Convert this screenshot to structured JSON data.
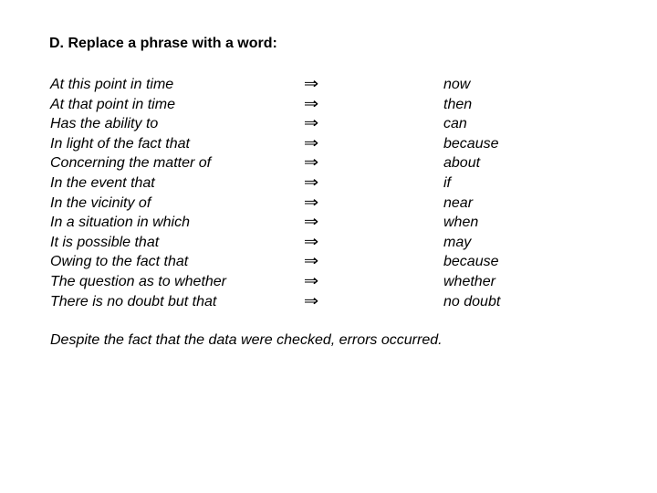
{
  "slide": {
    "title": "D. Replace a phrase with a word:",
    "arrow_symbol": "⇒",
    "rows": [
      {
        "phrase": "At this point in time",
        "word": "now"
      },
      {
        "phrase": "At that point in time",
        "word": "then"
      },
      {
        "phrase": "Has the ability to",
        "word": "can"
      },
      {
        "phrase": "In light of the fact that",
        "word": "because"
      },
      {
        "phrase": "Concerning the matter of",
        "word": "about"
      },
      {
        "phrase": "In the event that",
        "word": "if"
      },
      {
        "phrase": "In the vicinity of",
        "word": "near"
      },
      {
        "phrase": "In a situation in which",
        "word": "when"
      },
      {
        "phrase": "It is possible that",
        "word": "may"
      },
      {
        "phrase": "Owing to the fact that",
        "word": "because"
      },
      {
        "phrase": "The question as to whether",
        "word": "whether"
      },
      {
        "phrase": "There is no doubt but that",
        "word": "no doubt"
      }
    ],
    "example_sentence": "Despite the fact that the data were checked, errors occurred."
  }
}
